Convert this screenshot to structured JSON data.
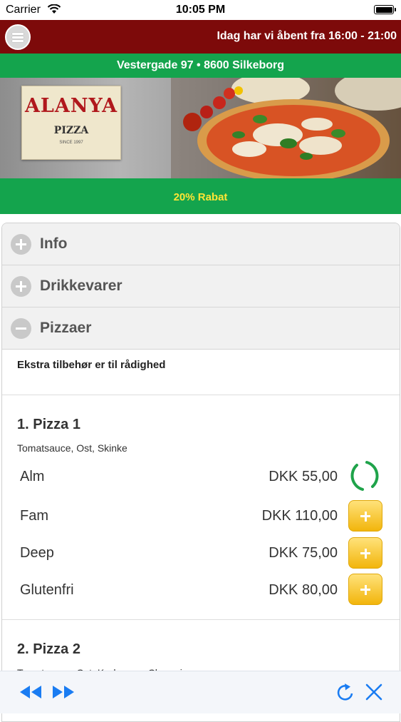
{
  "status": {
    "carrier": "Carrier",
    "time": "10:05 PM"
  },
  "header": {
    "hours": "Idag har vi åbent fra 16:00 - 21:00"
  },
  "address": "Vestergade 97 • 8600 Silkeborg",
  "logo": {
    "name": "ALANYA",
    "sub": "PIZZA",
    "since": "SINCE 1997"
  },
  "promo": "20% Rabat",
  "sections": [
    {
      "label": "Info",
      "state": "collapsed"
    },
    {
      "label": "Drikkevarer",
      "state": "collapsed"
    },
    {
      "label": "Pizzaer",
      "state": "expanded"
    }
  ],
  "extra_note": "Ekstra tilbehør er til rådighed",
  "items": [
    {
      "title": "1. Pizza 1",
      "desc": "Tomatsauce, Ost, Skinke",
      "variants": [
        {
          "name": "Alm",
          "price": "DKK   55,00",
          "state": "loading"
        },
        {
          "name": "Fam",
          "price": "DKK 110,00"
        },
        {
          "name": "Deep",
          "price": "DKK   75,00"
        },
        {
          "name": "Glutenfri",
          "price": "DKK   80,00"
        }
      ]
    },
    {
      "title": "2. Pizza 2",
      "desc": "Tomatsauce, Ost, Kødsauce, Champignon"
    }
  ],
  "colors": {
    "topbar": "#7d0a0a",
    "green": "#14a44d",
    "promo_text": "#ffe536",
    "add_button": "#f7c21e",
    "ios_blue": "#1a7cf2"
  },
  "icons": {
    "menu": "hamburger-icon",
    "back": "rewind-icon",
    "forward": "fast-forward-icon",
    "reload": "refresh-icon",
    "close": "close-icon"
  }
}
